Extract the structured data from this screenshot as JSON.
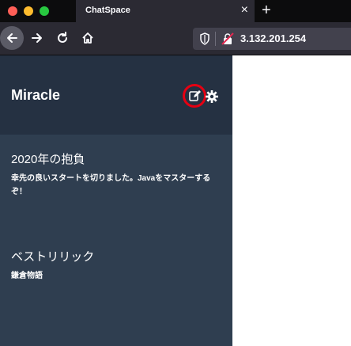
{
  "browser": {
    "tab_title": "ChatSpace",
    "tab_close": "×",
    "new_tab": "+",
    "url": "3.132.201.254"
  },
  "sidebar": {
    "user_name": "Miracle",
    "groups": [
      {
        "name": "2020年の抱負",
        "last_message": "幸先の良いスタートを切りました。Javaをマスターするぞ！"
      },
      {
        "name": "ベストリリック",
        "last_message": "鎌倉物語"
      }
    ]
  },
  "colors": {
    "sidebar_header": "#253142",
    "sidebar_body": "#2f3e50",
    "highlight_ring": "#e60012"
  }
}
